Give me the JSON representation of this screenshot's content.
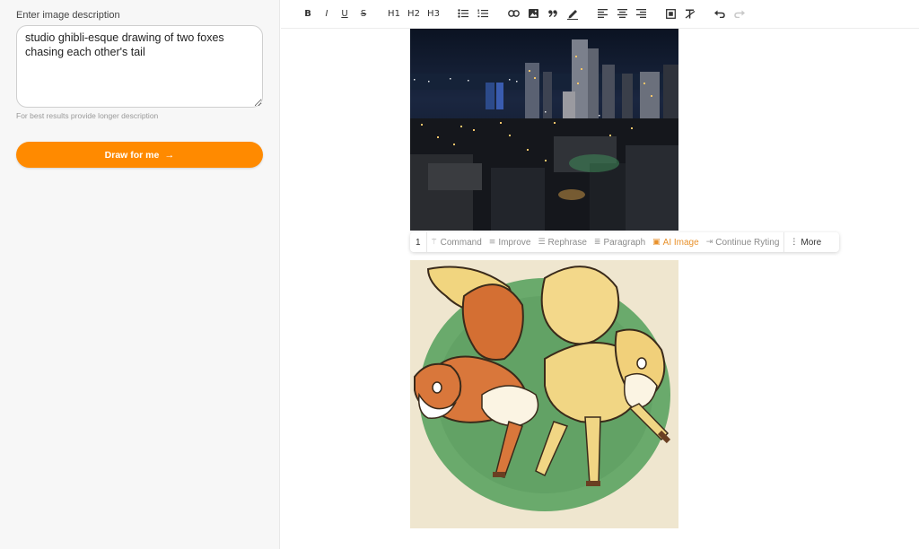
{
  "sidebar": {
    "label": "Enter image description",
    "description_value": "studio ghibli-esque drawing of two foxes chasing each other's tail",
    "hint": "For best results provide longer description",
    "draw_button": "Draw for me",
    "draw_arrow": "→",
    "accent": "#ff8a00"
  },
  "toolbar": {
    "bold": "B",
    "italic": "I",
    "underline": "U",
    "strike": "S",
    "h1": "H1",
    "h2": "H2",
    "h3": "H3",
    "icons": [
      "bullet-list-icon",
      "ordered-list-icon",
      "link-icon",
      "image-icon",
      "quote-icon",
      "highlight-pen-icon",
      "align-left-icon",
      "align-center-icon",
      "align-right-icon",
      "embed-icon",
      "clear-format-icon",
      "undo-icon",
      "redo-icon"
    ]
  },
  "bubble_menu": {
    "number": "1",
    "items": [
      "Command",
      "Improve",
      "Rephrase",
      "Paragraph",
      "AI Image",
      "Continue Ryting",
      "More"
    ],
    "active_color": "#e8912b"
  }
}
